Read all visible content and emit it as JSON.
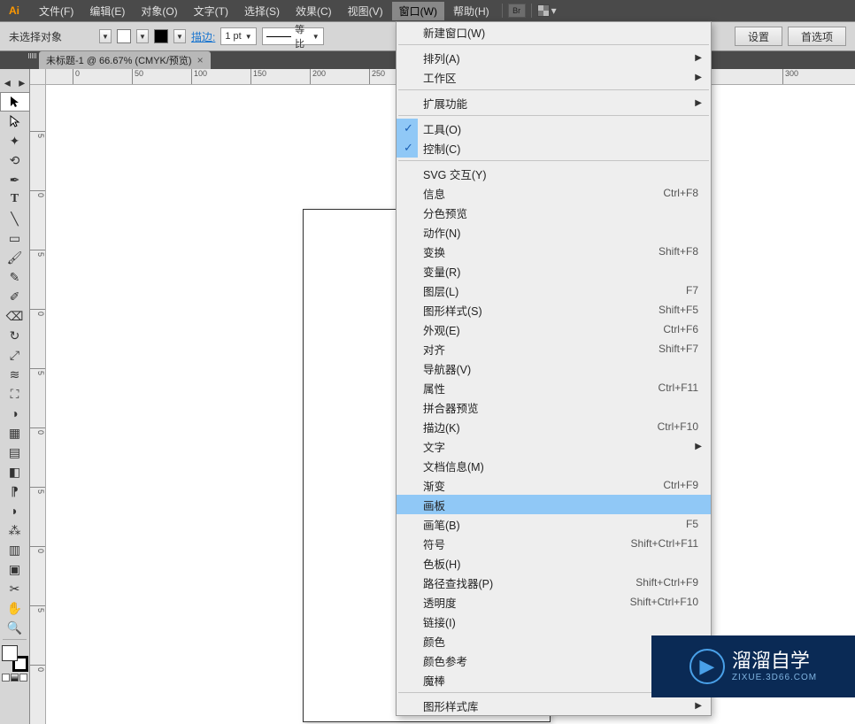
{
  "app_icon": "Ai",
  "menubar": [
    "文件(F)",
    "编辑(E)",
    "对象(O)",
    "文字(T)",
    "选择(S)",
    "效果(C)",
    "视图(V)",
    "窗口(W)",
    "帮助(H)"
  ],
  "menubar_active_index": 7,
  "mb_br": "Br",
  "controlbar": {
    "no_selection": "未选择对象",
    "stroke_label": "描边:",
    "stroke_weight": "1 pt",
    "uniform_label": "等比",
    "btn_settings": "设置",
    "btn_prefs": "首选项"
  },
  "doctab": "未标题-1 @ 66.67% (CMYK/预览)",
  "ruler_h_ticks": [
    {
      "pos": 30,
      "label": "0"
    },
    {
      "pos": 97,
      "label": "50"
    },
    {
      "pos": 164,
      "label": "100"
    },
    {
      "pos": 231,
      "label": "150"
    },
    {
      "pos": 298,
      "label": "200"
    },
    {
      "pos": 365,
      "label": "250"
    },
    {
      "pos": 832,
      "label": "300"
    }
  ],
  "ruler_v_ticks": [
    {
      "pos": 52,
      "label": "5"
    },
    {
      "pos": 119,
      "label": "0"
    },
    {
      "pos": 186,
      "label": "5"
    },
    {
      "pos": 253,
      "label": "0"
    },
    {
      "pos": 320,
      "label": "5"
    },
    {
      "pos": 387,
      "label": "0"
    },
    {
      "pos": 454,
      "label": "5"
    },
    {
      "pos": 521,
      "label": "0"
    },
    {
      "pos": 588,
      "label": "5"
    },
    {
      "pos": 655,
      "label": "0"
    }
  ],
  "dropdown": {
    "groups": [
      [
        {
          "label": "新建窗口(W)"
        }
      ],
      [
        {
          "label": "排列(A)",
          "sub": true
        },
        {
          "label": "工作区",
          "sub": true
        }
      ],
      [
        {
          "label": "扩展功能",
          "sub": true
        }
      ],
      [
        {
          "label": "工具(O)",
          "check": true
        },
        {
          "label": "控制(C)",
          "check": true
        }
      ],
      [
        {
          "label": "SVG 交互(Y)"
        },
        {
          "label": "信息",
          "accel": "Ctrl+F8"
        },
        {
          "label": "分色预览"
        },
        {
          "label": "动作(N)"
        },
        {
          "label": "变换",
          "accel": "Shift+F8"
        },
        {
          "label": "变量(R)"
        },
        {
          "label": "图层(L)",
          "accel": "F7"
        },
        {
          "label": "图形样式(S)",
          "accel": "Shift+F5"
        },
        {
          "label": "外观(E)",
          "accel": "Ctrl+F6"
        },
        {
          "label": "对齐",
          "accel": "Shift+F7"
        },
        {
          "label": "导航器(V)"
        },
        {
          "label": "属性",
          "accel": "Ctrl+F11"
        },
        {
          "label": "拼合器预览"
        },
        {
          "label": "描边(K)",
          "accel": "Ctrl+F10"
        },
        {
          "label": "文字",
          "sub": true
        },
        {
          "label": "文档信息(M)"
        },
        {
          "label": "渐变",
          "accel": "Ctrl+F9"
        },
        {
          "label": "画板",
          "hl": true
        },
        {
          "label": "画笔(B)",
          "accel": "F5"
        },
        {
          "label": "符号",
          "accel": "Shift+Ctrl+F11"
        },
        {
          "label": "色板(H)"
        },
        {
          "label": "路径查找器(P)",
          "accel": "Shift+Ctrl+F9"
        },
        {
          "label": "透明度",
          "accel": "Shift+Ctrl+F10"
        },
        {
          "label": "链接(I)"
        },
        {
          "label": "颜色"
        },
        {
          "label": "颜色参考"
        },
        {
          "label": "魔棒"
        }
      ],
      [
        {
          "label": "图形样式库",
          "sub": true
        }
      ]
    ]
  },
  "watermark": {
    "brand": "溜溜自学",
    "sub": "ZIXUE.3D66.COM"
  },
  "tools": [
    "selection",
    "direct-selection",
    "magic-wand",
    "lasso",
    "pen",
    "type",
    "line",
    "rectangle",
    "paintbrush",
    "pencil",
    "blob-brush",
    "eraser",
    "rotate",
    "scale",
    "width",
    "free-transform",
    "shape-builder",
    "perspective-grid",
    "mesh",
    "gradient",
    "eyedropper",
    "blend",
    "symbol-sprayer",
    "column-graph",
    "artboard",
    "slice",
    "hand",
    "zoom"
  ]
}
